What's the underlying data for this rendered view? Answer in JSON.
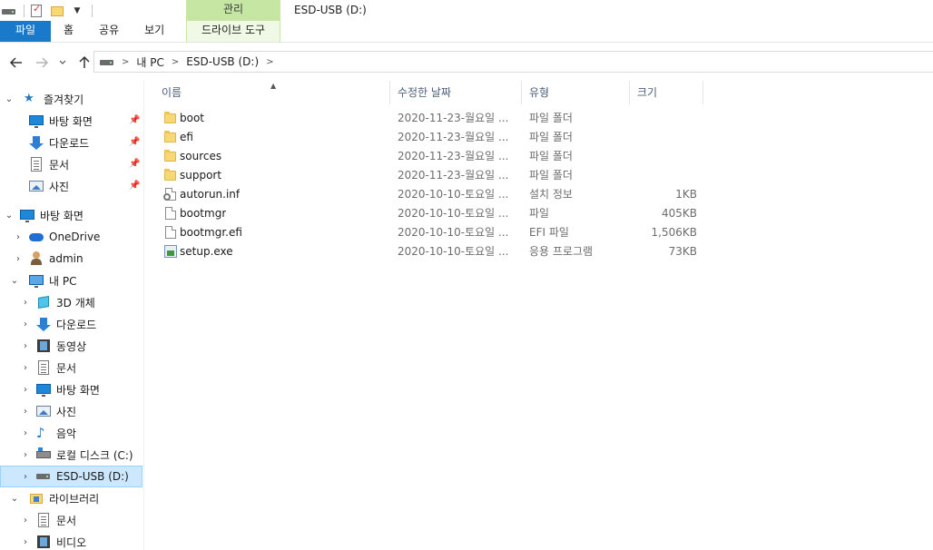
{
  "window": {
    "title": "ESD-USB (D:)",
    "context_group": "관리"
  },
  "ribbon": {
    "tabs": [
      {
        "label": "파일"
      },
      {
        "label": "홈"
      },
      {
        "label": "공유"
      },
      {
        "label": "보기"
      },
      {
        "label": "드라이브 도구"
      }
    ]
  },
  "address": {
    "crumbs": [
      "내 PC",
      "ESD-USB (D:)"
    ]
  },
  "sidebar": {
    "items": [
      {
        "label": "즐겨찾기",
        "icon": "star-icon"
      },
      {
        "label": "바탕 화면",
        "icon": "desktop-icon"
      },
      {
        "label": "다운로드",
        "icon": "download-icon"
      },
      {
        "label": "문서",
        "icon": "document-icon"
      },
      {
        "label": "사진",
        "icon": "pictures-icon"
      },
      {
        "label": "바탕 화면",
        "icon": "desktop-icon"
      },
      {
        "label": "OneDrive",
        "icon": "onedrive-icon"
      },
      {
        "label": "admin",
        "icon": "user-icon"
      },
      {
        "label": "내 PC",
        "icon": "this-pc-icon"
      },
      {
        "label": "3D 개체",
        "icon": "3d-objects-icon"
      },
      {
        "label": "다운로드",
        "icon": "download-icon"
      },
      {
        "label": "동영상",
        "icon": "videos-icon"
      },
      {
        "label": "문서",
        "icon": "document-icon"
      },
      {
        "label": "바탕 화면",
        "icon": "desktop-icon"
      },
      {
        "label": "사진",
        "icon": "pictures-icon"
      },
      {
        "label": "음악",
        "icon": "music-icon"
      },
      {
        "label": "로컬 디스크 (C:)",
        "icon": "local-disk-icon"
      },
      {
        "label": "ESD-USB (D:)",
        "icon": "usb-drive-icon"
      },
      {
        "label": "라이브러리",
        "icon": "libraries-icon"
      },
      {
        "label": "문서",
        "icon": "document-icon"
      },
      {
        "label": "비디오",
        "icon": "videos-icon"
      }
    ]
  },
  "columns": {
    "name": "이름",
    "date": "수정한 날짜",
    "type": "유형",
    "size": "크기"
  },
  "files": [
    {
      "name": "boot",
      "date": "2020-11-23-월요일 ...",
      "type": "파일 폴더",
      "size": "",
      "icon": "folder-icon"
    },
    {
      "name": "efi",
      "date": "2020-11-23-월요일 ...",
      "type": "파일 폴더",
      "size": "",
      "icon": "folder-icon"
    },
    {
      "name": "sources",
      "date": "2020-11-23-월요일 ...",
      "type": "파일 폴더",
      "size": "",
      "icon": "folder-icon"
    },
    {
      "name": "support",
      "date": "2020-11-23-월요일 ...",
      "type": "파일 폴더",
      "size": "",
      "icon": "folder-icon"
    },
    {
      "name": "autorun.inf",
      "date": "2020-10-10-토요일 ...",
      "type": "설치 정보",
      "size": "1KB",
      "icon": "setup-info-icon"
    },
    {
      "name": "bootmgr",
      "date": "2020-10-10-토요일 ...",
      "type": "파일",
      "size": "405KB",
      "icon": "file-icon"
    },
    {
      "name": "bootmgr.efi",
      "date": "2020-10-10-토요일 ...",
      "type": "EFI 파일",
      "size": "1,506KB",
      "icon": "file-icon"
    },
    {
      "name": "setup.exe",
      "date": "2020-10-10-토요일 ...",
      "type": "응용 프로그램",
      "size": "73KB",
      "icon": "application-icon"
    }
  ],
  "colors": {
    "file_tab": "#1979ca",
    "context_tab": "#c6e7a4",
    "selection": "#cce8ff",
    "column_header_text": "#4c607a",
    "secondary_text": "#6d6d6d"
  }
}
